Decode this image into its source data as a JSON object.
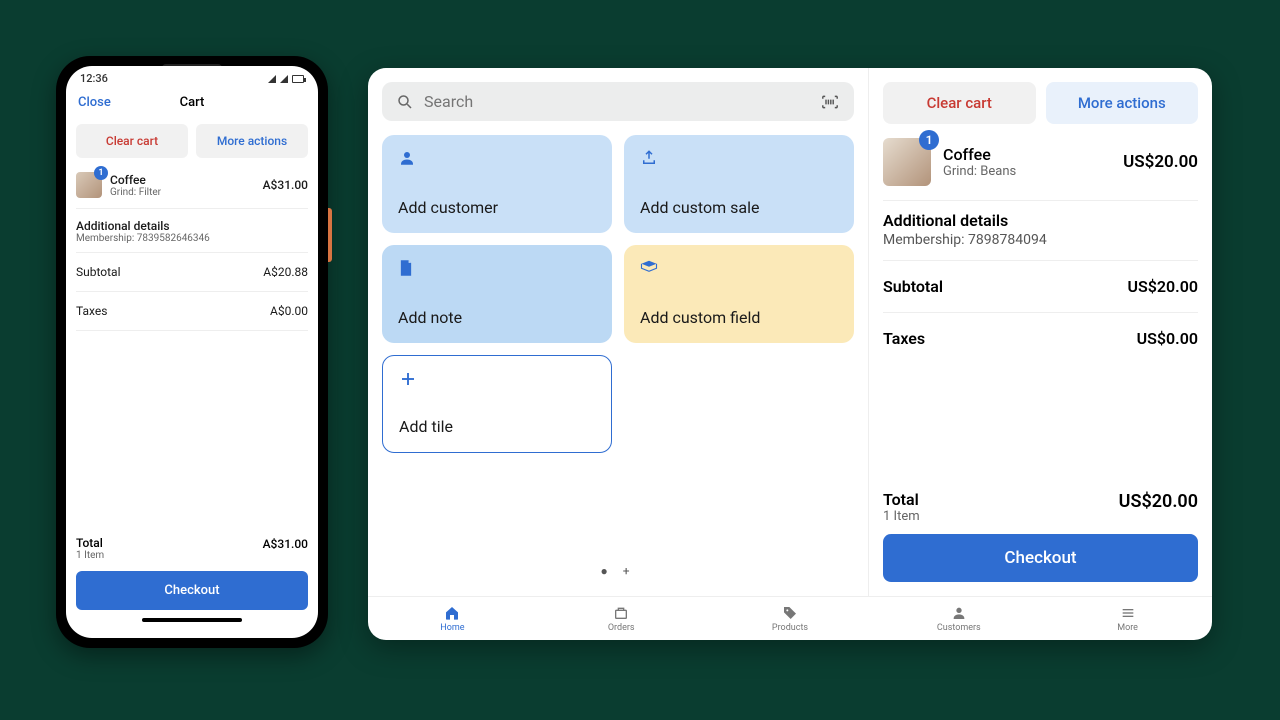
{
  "phone": {
    "status_time": "12:36",
    "close_label": "Close",
    "title": "Cart",
    "clear_cart_label": "Clear cart",
    "more_actions_label": "More actions",
    "item": {
      "badge": "1",
      "name": "Coffee",
      "sub": "Grind: Filter",
      "price": "A$31.00"
    },
    "details_label": "Additional details",
    "details_sub": "Membership: 7839582646346",
    "subtotal_label": "Subtotal",
    "subtotal_value": "A$20.88",
    "taxes_label": "Taxes",
    "taxes_value": "A$0.00",
    "total_label": "Total",
    "total_sub": "1 Item",
    "total_value": "A$31.00",
    "checkout_label": "Checkout"
  },
  "tablet": {
    "search_placeholder": "Search",
    "tiles": {
      "add_customer": "Add customer",
      "add_custom_sale": "Add custom sale",
      "add_note": "Add note",
      "add_custom_field": "Add custom field",
      "add_tile": "Add tile"
    },
    "pager": "●  +",
    "cart": {
      "clear_cart_label": "Clear cart",
      "more_actions_label": "More actions",
      "item": {
        "badge": "1",
        "name": "Coffee",
        "sub": "Grind: Beans",
        "price": "US$20.00"
      },
      "details_label": "Additional details",
      "details_sub": "Membership: 7898784094",
      "subtotal_label": "Subtotal",
      "subtotal_value": "US$20.00",
      "taxes_label": "Taxes",
      "taxes_value": "US$0.00",
      "total_label": "Total",
      "total_sub": "1 Item",
      "total_value": "US$20.00",
      "checkout_label": "Checkout"
    },
    "nav": {
      "home": "Home",
      "orders": "Orders",
      "products": "Products",
      "customers": "Customers",
      "more": "More"
    }
  }
}
